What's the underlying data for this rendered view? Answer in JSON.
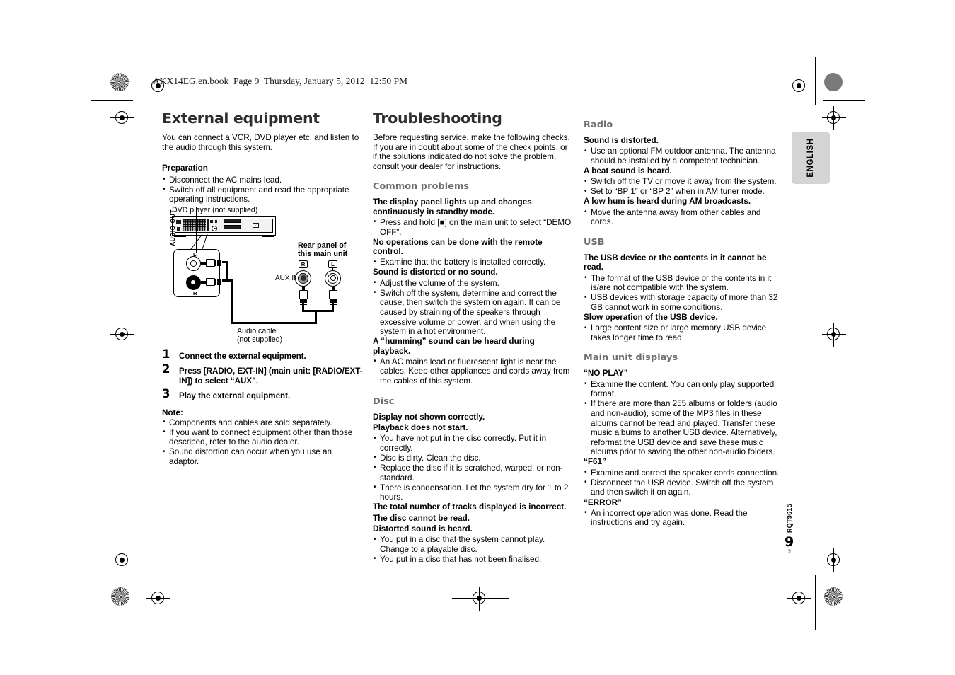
{
  "header": {
    "filestamp": "AKX14EG.en.book  Page 9  Thursday, January 5, 2012  12:50 PM"
  },
  "sidetab": {
    "label": "ENGLISH"
  },
  "footer": {
    "doc_code": "RQT9615",
    "page_number": "9",
    "page_number_sub": "9"
  },
  "col1": {
    "title": "External equipment",
    "lead": "You can connect a VCR, DVD player etc. and listen to the audio through this system.",
    "preparation_label": "Preparation",
    "preparation_items": [
      "Disconnect the AC mains lead.",
      "Switch off all equipment and read the appropriate operating instructions."
    ],
    "diagram": {
      "dvd_label": "DVD player (not supplied)",
      "audio_out_label": "AUDIO OUT",
      "audio_out_left": "L",
      "audio_out_right": "R",
      "rear_panel_label_line1": "Rear panel of",
      "rear_panel_label_line2": "this main unit",
      "aux_in_label": "AUX IN",
      "aux_right_tag": "R",
      "aux_left_tag": "L",
      "cable_label_line1": "Audio cable",
      "cable_label_line2": "(not supplied)"
    },
    "steps": [
      {
        "num": "1",
        "text": "Connect the external equipment."
      },
      {
        "num": "2",
        "text": "Press [RADIO, EXT-IN] (main unit: [RADIO/EXT-IN]) to select “AUX”."
      },
      {
        "num": "3",
        "text": "Play the external equipment."
      }
    ],
    "note_label": "Note:",
    "note_items": [
      "Components and cables are sold separately.",
      "If you want to connect equipment other than those described, refer to the audio dealer.",
      "Sound distortion can occur when you use an adaptor."
    ]
  },
  "col2": {
    "title": "Troubleshooting",
    "lead": "Before requesting service, make the following checks. If you are in doubt about some of the check points, or if the solutions indicated do not solve the problem, consult your dealer for instructions.",
    "sections": [
      {
        "heading": "Common problems",
        "entries": [
          {
            "titles": [
              "The display panel lights up and changes continuously in standby mode."
            ],
            "bullets": [
              "Press and hold [■] on the main unit to select “DEMO OFF”."
            ]
          },
          {
            "titles": [
              "No operations can be done with the remote control."
            ],
            "bullets": [
              "Examine that the battery is installed correctly."
            ]
          },
          {
            "titles": [
              "Sound is distorted or no sound."
            ],
            "bullets": [
              "Adjust the volume of the system.",
              "Switch off the system, determine and correct the cause, then switch the system on again. It can be caused by straining of the speakers through excessive volume or power, and when using the system in a hot environment."
            ]
          },
          {
            "titles": [
              "A “humming” sound can be heard during playback."
            ],
            "bullets": [
              "An AC mains lead or fluorescent light is near the cables. Keep other appliances and cords away from the cables of this system."
            ]
          }
        ]
      },
      {
        "heading": "Disc",
        "entries": [
          {
            "titles": [
              "Display not shown correctly.",
              "Playback does not start."
            ],
            "bullets": [
              "You have not put in the disc correctly. Put it in correctly.",
              "Disc is dirty. Clean the disc.",
              "Replace the disc if it is scratched, warped, or non-standard.",
              "There is condensation. Let the system dry for 1 to 2 hours."
            ]
          },
          {
            "titles": [
              "The total number of tracks displayed is incorrect.",
              "The disc cannot be read.",
              "Distorted sound is heard."
            ],
            "bullets": [
              "You put in a disc that the system cannot play. Change to a playable disc.",
              "You put in a disc that has not been finalised."
            ]
          }
        ]
      }
    ]
  },
  "col3": {
    "sections": [
      {
        "heading": "Radio",
        "entries": [
          {
            "titles": [
              "Sound is distorted."
            ],
            "bullets": [
              "Use an optional FM outdoor antenna. The antenna should be installed by a competent technician."
            ]
          },
          {
            "titles": [
              "A beat sound is heard."
            ],
            "bullets": [
              "Switch off the TV or move it away from the system.",
              "Set to “BP 1” or “BP 2” when in AM tuner mode."
            ]
          },
          {
            "titles": [
              "A low hum is heard during AM broadcasts."
            ],
            "bullets": [
              "Move the antenna away from other cables and cords."
            ]
          }
        ]
      },
      {
        "heading": "USB",
        "entries": [
          {
            "titles": [
              "The USB device or the contents in it cannot be read."
            ],
            "bullets": [
              "The format of the USB device or the contents in it is/are not compatible with the system.",
              "USB devices with storage capacity of more than 32 GB cannot work in some conditions."
            ]
          },
          {
            "titles": [
              "Slow operation of the USB device."
            ],
            "bullets": [
              "Large content size or large memory USB device takes longer time to read."
            ]
          }
        ]
      },
      {
        "heading": "Main unit displays",
        "entries": [
          {
            "titles": [
              "“NO PLAY”"
            ],
            "bullets": [
              "Examine the content. You can only play supported format.",
              "If there are more than 255 albums or folders (audio and non-audio), some of the MP3 files in these albums cannot be read and played. Transfer these music albums to another USB device. Alternatively, reformat the USB device and save these music albums prior to saving the other non-audio folders."
            ]
          },
          {
            "titles": [
              "“F61”"
            ],
            "bullets": [
              "Examine and correct the speaker cords connection.",
              "Disconnect the USB device. Switch off the system and then switch it on again."
            ]
          },
          {
            "titles": [
              "“ERROR”"
            ],
            "bullets": [
              "An incorrect operation was done. Read the instructions and try again."
            ]
          }
        ]
      }
    ]
  }
}
